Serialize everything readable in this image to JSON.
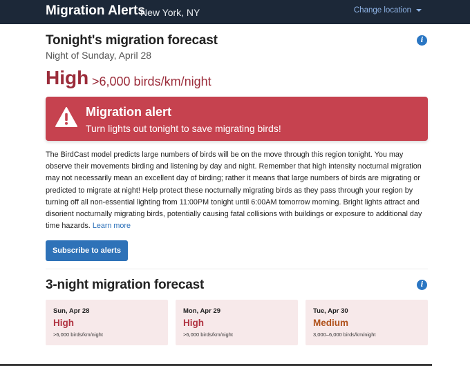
{
  "header": {
    "brand": "Migration Alerts",
    "region": "New York, NY",
    "change_location": "Change location"
  },
  "forecast": {
    "title": "Tonight's migration forecast",
    "subtitle": "Night of Sunday, April 28",
    "level": "High",
    "range": ">6,000 birds/km/night"
  },
  "alert": {
    "title": "Migration alert",
    "message": "Turn lights out tonight to save migrating birds!"
  },
  "description": "The BirdCast model predicts large numbers of birds will be on the move through this region tonight. You may observe their movements birding and listening by day and night. Remember that high intensity nocturnal migration may not necessarily mean an excellent day of birding; rather it means that large numbers of birds are migrating or predicted to migrate at night! Help protect these nocturnally migrating birds as they pass through your region by turning off all non-essential lighting from 11:00PM tonight until 6:00AM tomorrow morning. Bright lights attract and disorient nocturnally migrating birds, potentially causing fatal collisions with buildings or exposure to additional day time hazards.",
  "learn_more": "Learn more",
  "subscribe": "Subscribe to alerts",
  "three_night": {
    "title": "3-night migration forecast",
    "cards": [
      {
        "day": "Sun, Apr 28",
        "level": "High",
        "range": ">6,000 birds/km/night",
        "color": "#b03341"
      },
      {
        "day": "Mon, Apr 29",
        "level": "High",
        "range": ">6,000 birds/km/night",
        "color": "#b03341"
      },
      {
        "day": "Tue, Apr 30",
        "level": "Medium",
        "range": "3,000–6,000 birds/km/night",
        "color": "#b0521c"
      }
    ]
  },
  "colors": {
    "header_bg": "#1c2838",
    "alert_bg": "#c6424f",
    "accent_blue": "#2e72b8",
    "high_red": "#9b2c3a",
    "card_bg": "#f7e9ea"
  },
  "icons": {
    "info": "info-icon",
    "warning": "warning-triangle-icon",
    "dropdown": "chevron-down-icon"
  }
}
